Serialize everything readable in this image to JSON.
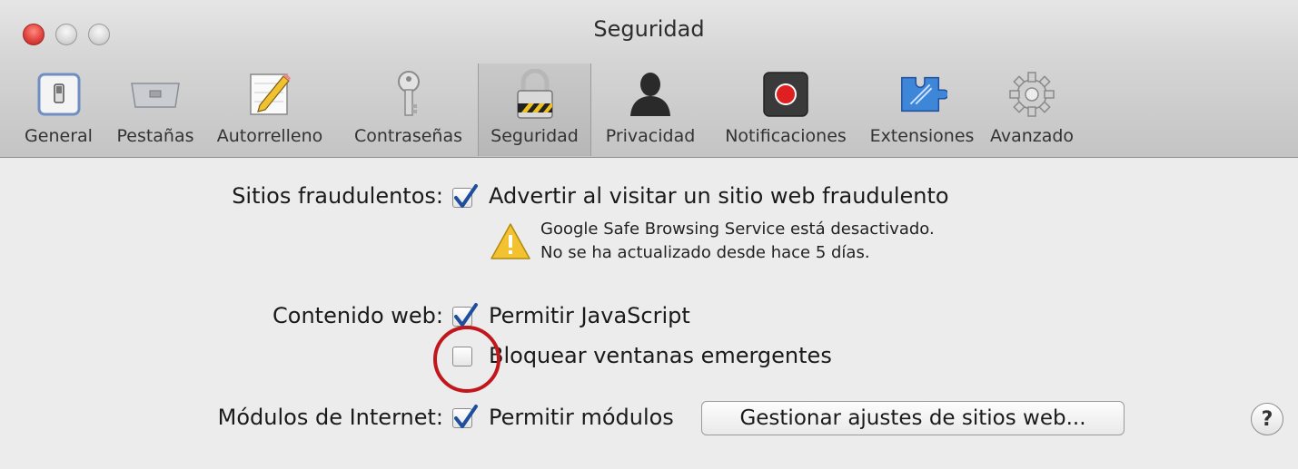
{
  "window": {
    "title": "Seguridad"
  },
  "toolbar": {
    "items": [
      {
        "label": "General",
        "icon": "general-switch-icon"
      },
      {
        "label": "Pestañas",
        "icon": "tabs-icon"
      },
      {
        "label": "Autorrelleno",
        "icon": "autofill-pencil-icon"
      },
      {
        "label": "Contraseñas",
        "icon": "key-icon"
      },
      {
        "label": "Seguridad",
        "icon": "padlock-icon",
        "selected": true
      },
      {
        "label": "Privacidad",
        "icon": "person-silhouette-icon"
      },
      {
        "label": "Notificaciones",
        "icon": "notification-record-icon"
      },
      {
        "label": "Extensiones",
        "icon": "extensions-puzzle-icon"
      },
      {
        "label": "Avanzado",
        "icon": "gear-icon"
      }
    ]
  },
  "security": {
    "fraud": {
      "label": "Sitios fraudulentos:",
      "option": "Advertir al visitar un sitio web fraudulento",
      "checked": true,
      "warning_line1": "Google Safe Browsing Service está desactivado.",
      "warning_line2": "No se ha actualizado desde hace 5 días."
    },
    "web_content": {
      "label": "Contenido web:",
      "javascript": "Permitir JavaScript",
      "javascript_checked": true,
      "popups": "Bloquear ventanas emergentes",
      "popups_checked": false
    },
    "plugins": {
      "label": "Módulos de Internet:",
      "option": "Permitir módulos",
      "checked": true,
      "manage_button": "Gestionar ajustes de sitios web..."
    },
    "help": "?"
  },
  "colors": {
    "check": "#1f4f9c",
    "annotation": "#c0161c",
    "warning": "#f2c230"
  }
}
